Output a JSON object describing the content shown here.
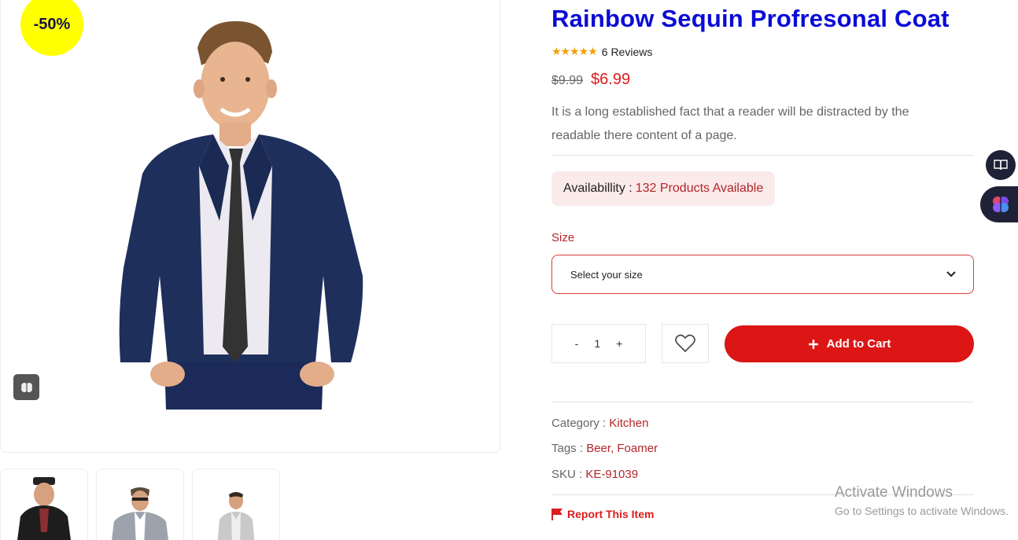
{
  "gallery": {
    "discount_badge": "-50%",
    "thumbnails": [
      "thumb-leather-jacket",
      "thumb-check-blazer",
      "thumb-check-shirt"
    ]
  },
  "product": {
    "title": "Rainbow Sequin Profresonal Coat",
    "rating": {
      "stars": "★★★★★",
      "value": 5,
      "reviews_label": "6 Reviews"
    },
    "old_price": "$9.99",
    "new_price": "$6.99",
    "description": "It is a long established fact that a reader will be distracted by the readable there content of a page.",
    "availability": {
      "label": "Availabillity :",
      "value": "132 Products Available"
    },
    "size": {
      "label": "Size",
      "placeholder": "Select your size"
    },
    "quantity": {
      "minus": "-",
      "value": "1",
      "plus": "+"
    },
    "add_to_cart": "Add to Cart",
    "meta": {
      "category_label": "Category :",
      "category_value": "Kitchen",
      "tags_label": "Tags :",
      "tags_value": "Beer, Foamer",
      "sku_label": "SKU :",
      "sku_value": "KE-91039"
    },
    "report": "Report This Item"
  },
  "watermark": {
    "line1": "Activate Windows",
    "line2": "Go to Settings to activate Windows."
  },
  "colors": {
    "title": "#0b0bd6",
    "accent_red": "#dc1515",
    "badge_yellow": "#ffff00",
    "availability_bg": "#fbeaea",
    "side_button_bg": "#1f2137",
    "star": "#f2a007"
  }
}
